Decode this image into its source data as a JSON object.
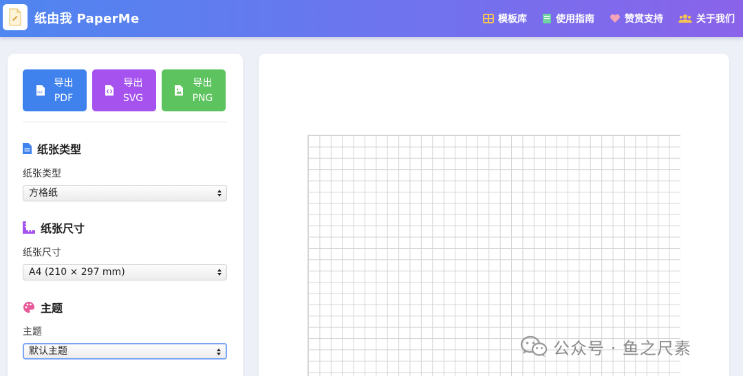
{
  "app": {
    "title": "纸由我 PaperMe"
  },
  "nav": [
    {
      "label": "模板库",
      "icon": "grid-icon"
    },
    {
      "label": "使用指南",
      "icon": "book-icon"
    },
    {
      "label": "赞赏支持",
      "icon": "heart-icon"
    },
    {
      "label": "关于我们",
      "icon": "users-icon"
    }
  ],
  "export": {
    "pdf": {
      "line1": "导出",
      "line2": "PDF",
      "color": "#3f82ee"
    },
    "svg": {
      "line1": "导出",
      "line2": "SVG",
      "color": "#a552ee"
    },
    "png": {
      "line1": "导出",
      "line2": "PNG",
      "color": "#5cc35e"
    }
  },
  "sections": {
    "paper_type": {
      "title": "纸张类型",
      "label": "纸张类型",
      "value": "方格纸"
    },
    "paper_size": {
      "title": "纸张尺寸",
      "label": "纸张尺寸",
      "value": "A4 (210 × 297 mm)"
    },
    "theme": {
      "title": "主题",
      "label": "主题",
      "value": "默认主题"
    }
  },
  "watermark": {
    "text": "公众号 · 鱼之尺素"
  },
  "colors": {
    "accent": "#4f86f0",
    "header_end": "#8a63ea",
    "grid_line": "#d4d4d4"
  }
}
